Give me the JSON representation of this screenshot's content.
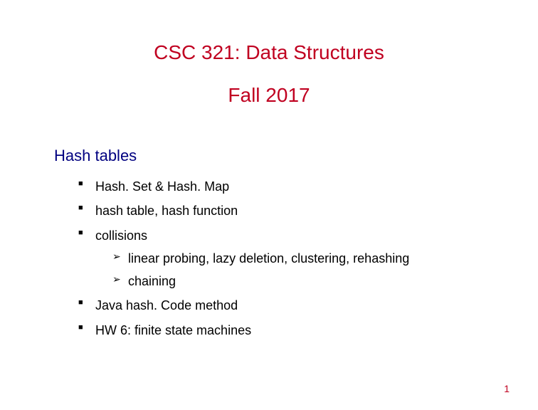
{
  "title": "CSC 321: Data Structures",
  "subtitle": "Fall 2017",
  "section_heading": "Hash tables",
  "bullets": {
    "b0": "Hash. Set & Hash. Map",
    "b1": "hash table, hash function",
    "b2": "collisions",
    "b2_sub0": "linear probing, lazy deletion, clustering, rehashing",
    "b2_sub1": "chaining",
    "b3": "Java hash. Code method",
    "b4": "HW 6: finite state machines"
  },
  "page_number": "1"
}
